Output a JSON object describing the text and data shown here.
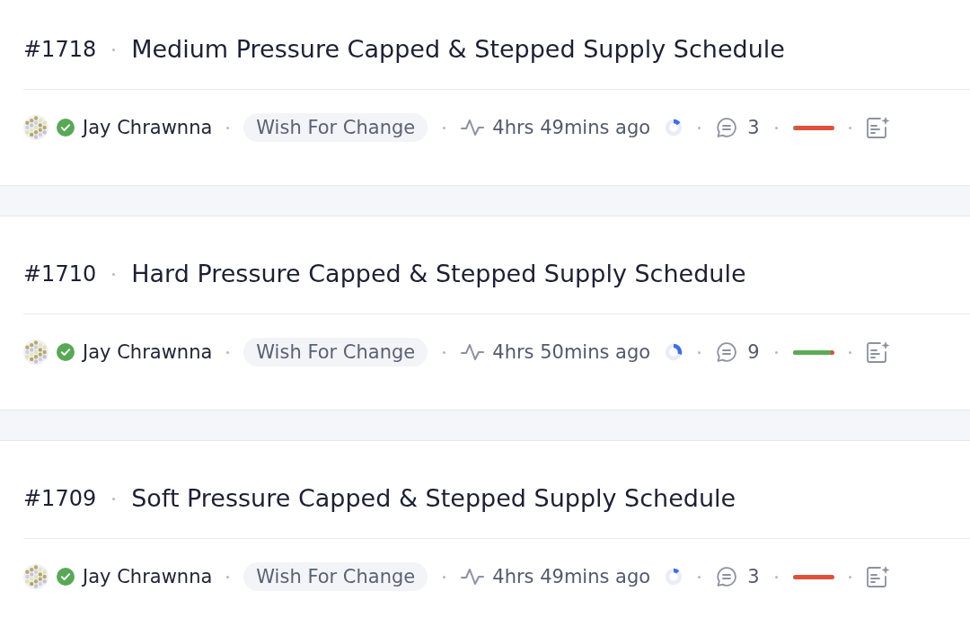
{
  "proposals": [
    {
      "number": "#1718",
      "title": "Medium Pressure Capped & Stepped Supply Schedule",
      "author": {
        "name": "Jay Chrawnna",
        "verified": true
      },
      "tag": "Wish For Change",
      "updated": "4hrs 49mins ago",
      "progress": {
        "level": 0.15
      },
      "comments": "3",
      "vote_bar": {
        "level": 0.05
      }
    },
    {
      "number": "#1710",
      "title": "Hard Pressure Capped & Stepped Supply Schedule",
      "author": {
        "name": "Jay Chrawnna",
        "verified": true
      },
      "tag": "Wish For Change",
      "updated": "4hrs 50mins ago",
      "progress": {
        "level": 0.3
      },
      "comments": "9",
      "vote_bar": {
        "level": 0.93
      }
    },
    {
      "number": "#1709",
      "title": "Soft Pressure Capped & Stepped Supply Schedule",
      "author": {
        "name": "Jay Chrawnna",
        "verified": true
      },
      "tag": "Wish For Change",
      "updated": "4hrs 49mins ago",
      "progress": {
        "level": 0.12
      },
      "comments": "3",
      "vote_bar": {
        "level": 0.03
      }
    }
  ]
}
